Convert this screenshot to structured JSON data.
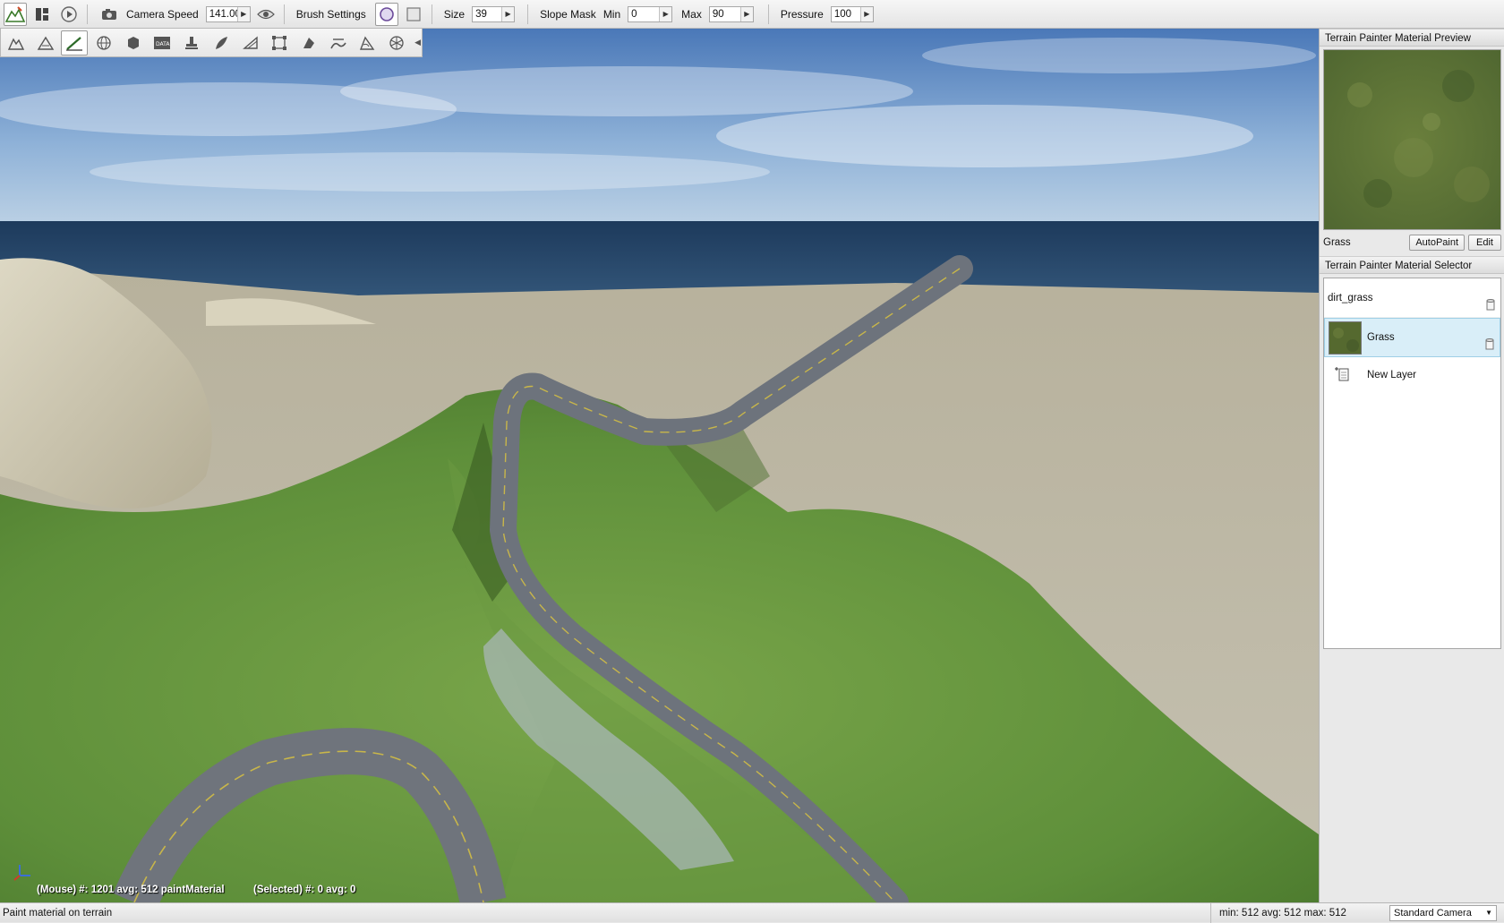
{
  "toolbar": {
    "camera_speed_label": "Camera Speed",
    "camera_speed_value": "141.00",
    "brush_settings_label": "Brush Settings",
    "size_label": "Size",
    "size_value": "39",
    "slope_mask_label": "Slope Mask",
    "min_label": "Min",
    "min_value": "0",
    "max_label": "Max",
    "max_value": "90",
    "pressure_label": "Pressure",
    "pressure_value": "100",
    "icons": [
      "terrain-editor-icon",
      "layout-icon",
      "play-icon",
      "camera-icon",
      "eye-icon",
      "circle-brush-icon",
      "square-brush-icon"
    ]
  },
  "tools": {
    "items": [
      "select-tool-icon",
      "raise-height-icon",
      "paint-material-icon",
      "globe-icon",
      "cube-icon",
      "datablock-icon",
      "stamp-icon",
      "brush-leaf-icon",
      "ramp-icon",
      "transform-icon",
      "smooth-icon",
      "flatten-icon",
      "slope-icon",
      "noise-icon"
    ],
    "active": "paint-material-icon"
  },
  "viewport": {
    "hud_mouse": "(Mouse) #: 1201  avg: 512 paintMaterial",
    "hud_selected": "(Selected) #: 0  avg: 0"
  },
  "panel": {
    "preview_title": "Terrain Painter Material Preview",
    "preview_material": "Grass",
    "autopaint_label": "AutoPaint",
    "edit_label": "Edit",
    "selector_title": "Terrain Painter Material Selector",
    "materials": [
      {
        "name": "dirt_grass",
        "selected": false
      },
      {
        "name": "Grass",
        "selected": true
      }
    ],
    "new_layer_label": "New Layer"
  },
  "statusbar": {
    "message": "Paint material on terrain",
    "stats": "min: 512  avg: 512  max: 512",
    "camera": "Standard Camera"
  }
}
